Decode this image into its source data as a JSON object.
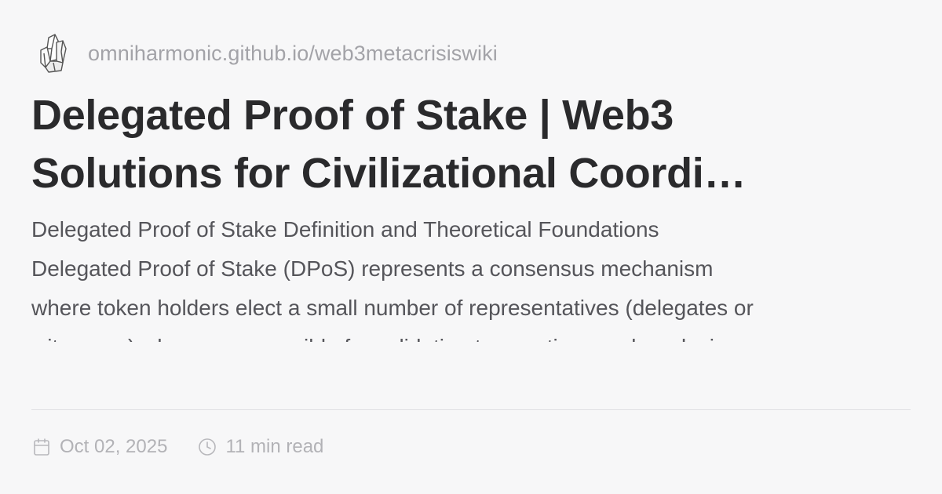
{
  "site": {
    "logo_icon": "crystal-cluster-icon",
    "url": "omniharmonic.github.io/web3metacrisiswiki"
  },
  "article": {
    "title_line1": "Delegated Proof of Stake | Web3",
    "title_line2": "Solutions for Civilizational Coordi…",
    "excerpt_lines": [
      "Delegated Proof of Stake Definition and Theoretical Foundations",
      "Delegated Proof of Stake (DPoS) represents a consensus mechanism",
      "where token holders elect a small number of representatives (delegates or",
      "witnesses) who are responsible for validating transactions and producing"
    ]
  },
  "meta": {
    "date_icon": "calendar-icon",
    "date": "Oct 02, 2025",
    "read_icon": "clock-icon",
    "read_time": "11 min read"
  },
  "colors": {
    "background": "#f7f7f8",
    "title": "#2a2a2c",
    "muted": "#a3a3a8"
  }
}
